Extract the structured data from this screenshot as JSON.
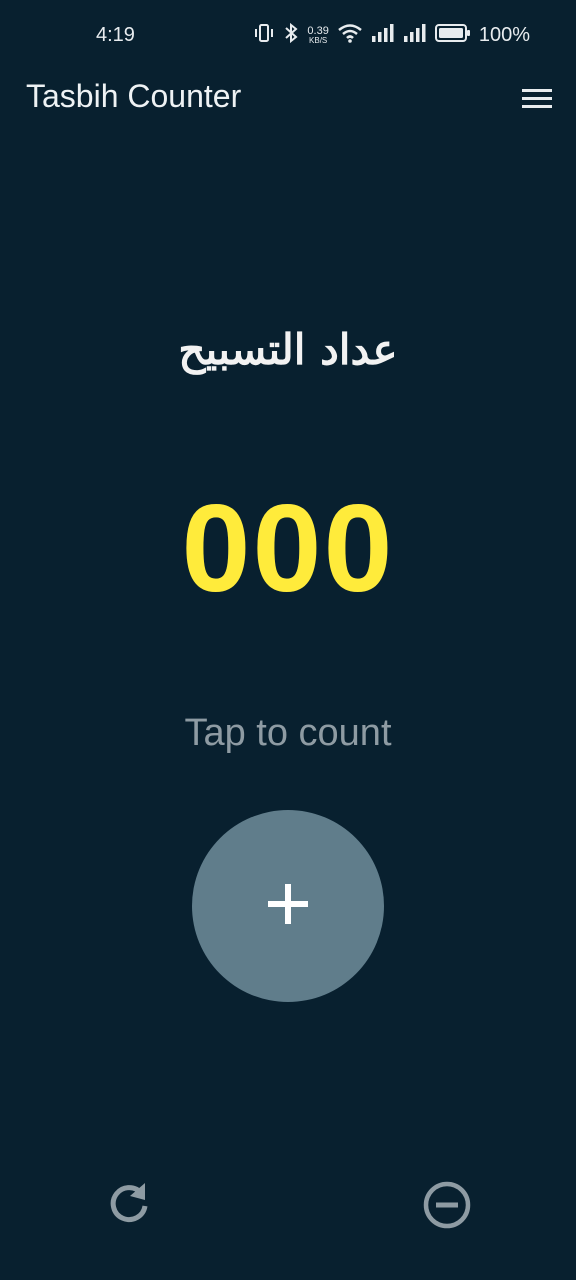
{
  "status_bar": {
    "time": "4:19",
    "net_speed_value": "0.39",
    "net_speed_unit": "KB/S",
    "battery_percent": "100%",
    "icons": [
      "vibrate-icon",
      "bluetooth-icon",
      "wifi-icon",
      "signal-icon",
      "signal-icon",
      "battery-icon"
    ]
  },
  "app_bar": {
    "title": "Tasbih Counter",
    "menu_icon": "hamburger-menu-icon"
  },
  "main": {
    "arabic_title": "عداد التسبيح",
    "counter": "000",
    "tap_hint": "Tap to count",
    "count_button_icon": "plus-icon"
  },
  "bottom_actions": {
    "reset_icon": "refresh-icon",
    "decrement_icon": "minus-circle-icon"
  },
  "colors": {
    "background": "#08202f",
    "counter": "#ffeb3b",
    "button": "#607d8b",
    "hint": "#8e9ba3"
  }
}
